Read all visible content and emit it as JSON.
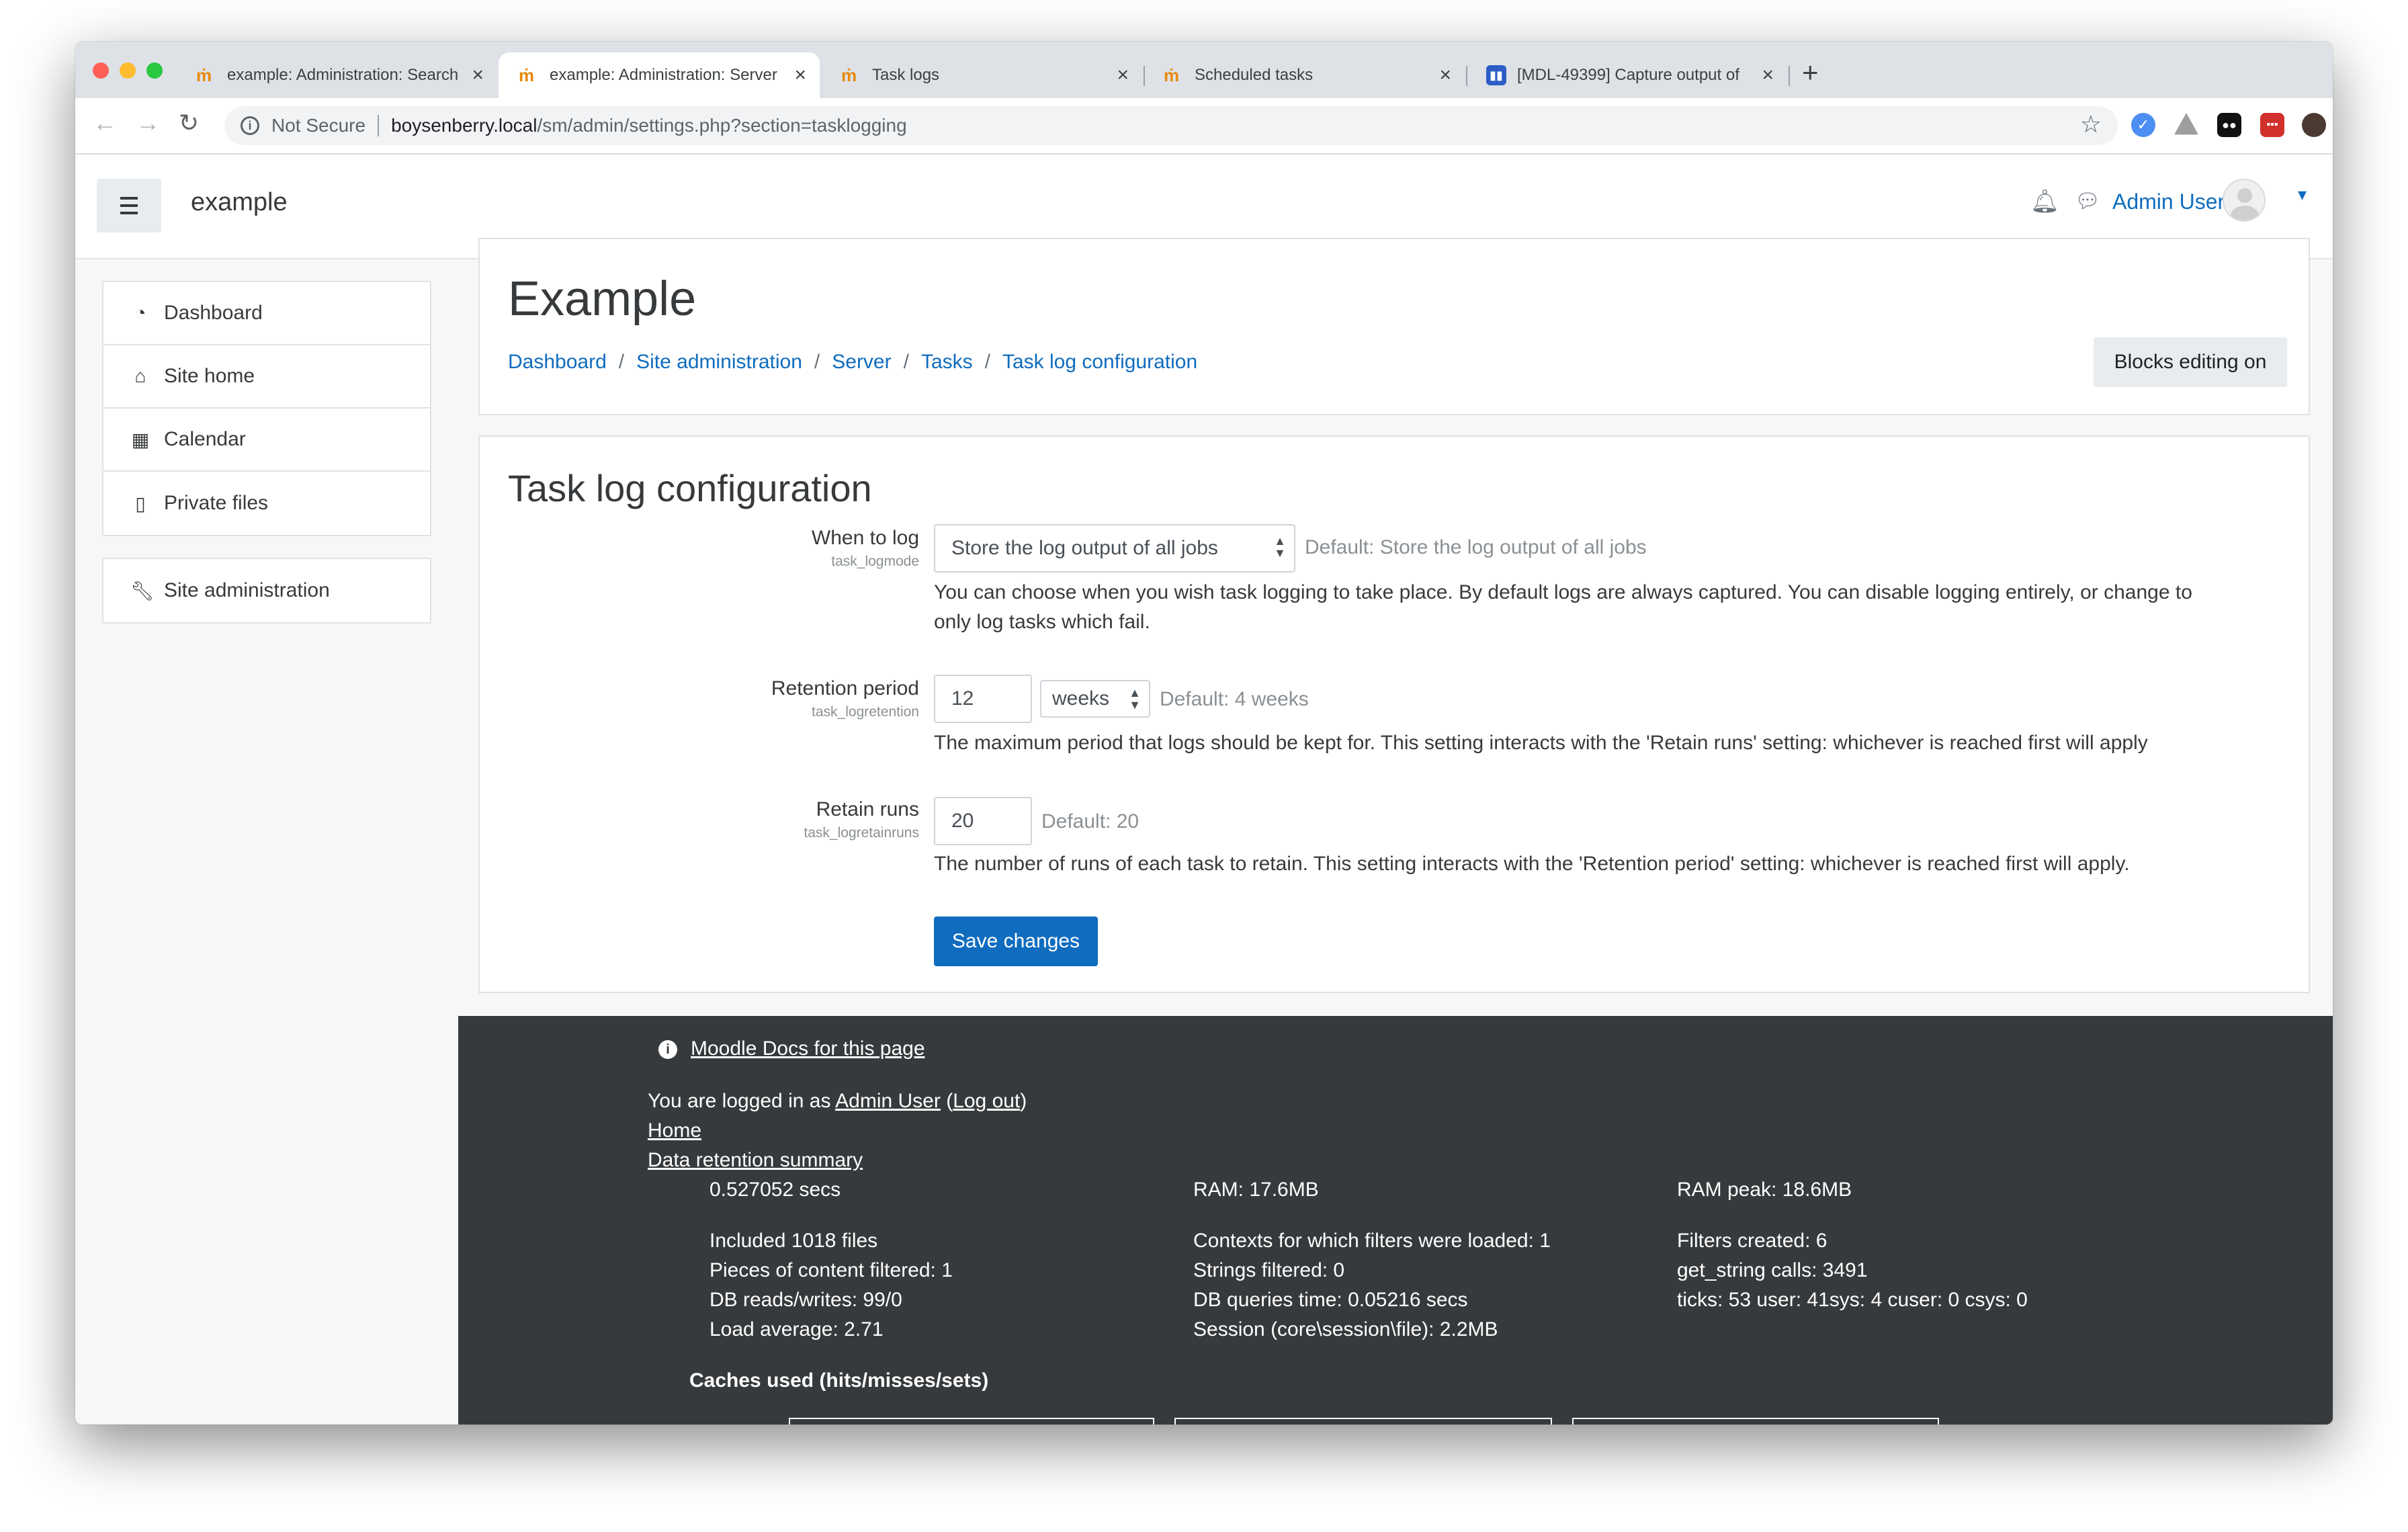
{
  "browser": {
    "tabs": [
      {
        "title": "example: Administration: Search"
      },
      {
        "title": "example: Administration: Server"
      },
      {
        "title": "Task logs"
      },
      {
        "title": "Scheduled tasks"
      },
      {
        "title": "[MDL-49399] Capture output of"
      }
    ],
    "security_label": "Not Secure",
    "url_host": "boysenberry.local",
    "url_path": "/sm/admin/settings.php?section=tasklogging"
  },
  "header": {
    "site_name": "example",
    "user_name": "Admin User"
  },
  "nav": {
    "items": [
      {
        "label": "Dashboard",
        "icon": "dashboard-icon"
      },
      {
        "label": "Site home",
        "icon": "home-icon"
      },
      {
        "label": "Calendar",
        "icon": "calendar-icon"
      },
      {
        "label": "Private files",
        "icon": "file-icon"
      }
    ],
    "admin": {
      "label": "Site administration",
      "icon": "wrench-icon"
    }
  },
  "page": {
    "heading": "Example",
    "breadcrumb": [
      "Dashboard",
      "Site administration",
      "Server",
      "Tasks",
      "Task log configuration"
    ],
    "breadcrumb_sep": "/",
    "blocks_editing_label": "Blocks editing on"
  },
  "form": {
    "title": "Task log configuration",
    "logmode": {
      "label": "When to log",
      "key": "task_logmode",
      "value": "Store the log output of all jobs",
      "default": "Default: Store the log output of all jobs",
      "desc_line1": "You can choose when you wish task logging to take place. By default logs are always captured. You can disable logging entirely, or change to",
      "desc_line2": "only log tasks which fail."
    },
    "retention": {
      "label": "Retention period",
      "key": "task_logretention",
      "value": "12",
      "unit": "weeks",
      "default": "Default: 4 weeks",
      "desc": "The maximum period that logs should be kept for. This setting interacts with the 'Retain runs' setting: whichever is reached first will apply"
    },
    "retainruns": {
      "label": "Retain runs",
      "key": "task_logretainruns",
      "value": "20",
      "default": "Default: 20",
      "desc": "The number of runs of each task to retain. This setting interacts with the 'Retention period' setting: whichever is reached first will apply."
    },
    "save_label": "Save changes"
  },
  "footer": {
    "docs_link": "Moodle Docs for this page",
    "logged_in_prefix": "You are logged in as",
    "logged_in_user": "Admin User",
    "logout_link": "Log out",
    "home_link": "Home",
    "data_retention_link": "Data retention summary",
    "perf": {
      "time": "0.527052 secs",
      "ram": "RAM: 17.6MB",
      "ram_peak": "RAM peak: 18.6MB",
      "included": "Included 1018 files",
      "contexts": "Contexts for which filters were loaded: 1",
      "filters_created": "Filters created: 6",
      "pieces": "Pieces of content filtered: 1",
      "strings": "Strings filtered: 0",
      "get_string": "get_string calls: 3491",
      "db_rw": "DB reads/writes: 99/0",
      "db_time": "DB queries time: 0.05216 secs",
      "ticks": "ticks: 53 user: 41sys: 4 cuser: 0 csys: 0",
      "load": "Load average: 2.71",
      "session": "Session (core\\session\\file): 2.2MB"
    },
    "caches_heading": "Caches used (hits/misses/sets)"
  }
}
